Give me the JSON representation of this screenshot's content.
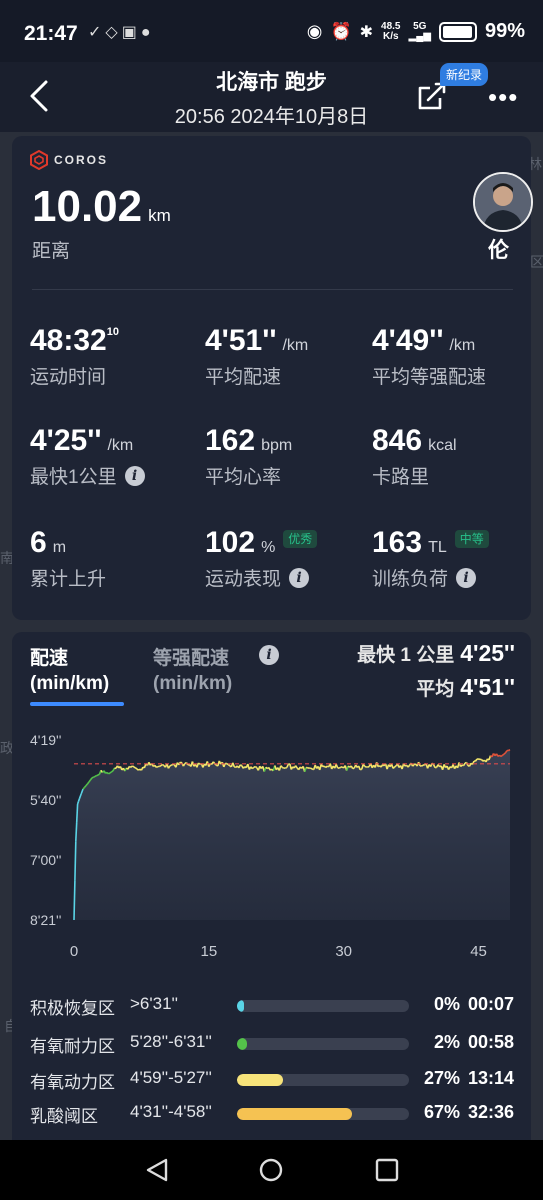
{
  "status_bar": {
    "time": "21:47",
    "battery": "99%",
    "net_speed_top": "48.5",
    "net_speed_bottom": "K/s",
    "signal": "5G"
  },
  "header": {
    "title": "北海市 跑步",
    "subtitle": "20:56 2024年10月8日",
    "badge": "新纪录"
  },
  "map_labels": [
    "林",
    "南",
    "区",
    "政",
    "自"
  ],
  "summary": {
    "brand": "COROS",
    "distance_value": "10.02",
    "distance_unit": "km",
    "distance_label": "距离",
    "user_name": "伦",
    "metrics": [
      {
        "value": "48:32",
        "sup": "10",
        "unit": "",
        "label": "运动时间"
      },
      {
        "value": "4'51''",
        "unit": "/km",
        "label": "平均配速"
      },
      {
        "value": "4'49''",
        "unit": "/km",
        "label": "平均等强配速"
      },
      {
        "value": "4'25''",
        "unit": "/km",
        "label": "最快1公里",
        "info": true
      },
      {
        "value": "162",
        "unit": "bpm",
        "label": "平均心率"
      },
      {
        "value": "846",
        "unit": "kcal",
        "label": "卡路里"
      },
      {
        "value": "6",
        "unit": "m",
        "label": "累计上升"
      },
      {
        "value": "102",
        "unit": "%",
        "tag": "优秀",
        "label": "运动表现",
        "info": true
      },
      {
        "value": "163",
        "unit": "TL",
        "tag": "中等",
        "label": "训练负荷",
        "info": true
      }
    ]
  },
  "pace_panel": {
    "tab_active": "配速",
    "tab_active_unit": "(min/km)",
    "tab_inactive": "等强配速",
    "tab_inactive_unit": "(min/km)",
    "fastest_label": "最快 1 公里",
    "fastest_value": "4'25''",
    "avg_label": "平均",
    "avg_value": "4'51''"
  },
  "chart_data": {
    "type": "area",
    "x_label": "",
    "y_label": "",
    "x_range": [
      0,
      48.5
    ],
    "x_ticks": [
      0,
      15,
      30,
      45
    ],
    "y_ticks": [
      "4'19''",
      "5'40''",
      "7'00''",
      "8'21''"
    ],
    "y_tick_seconds": [
      259,
      340,
      420,
      501
    ],
    "y_inverted": true,
    "reference_line": {
      "label": "average",
      "seconds": 291
    },
    "series": [
      {
        "x": [
          0,
          0.2,
          0.4,
          0.6,
          1,
          1.5,
          2,
          3,
          4,
          5,
          6,
          7,
          8,
          9,
          10,
          12,
          14,
          16,
          18,
          20,
          22,
          24,
          26,
          28,
          30,
          32,
          34,
          36,
          38,
          40,
          42,
          44,
          45,
          46,
          47,
          48,
          48.5
        ],
        "seconds": [
          501,
          395,
          345,
          338,
          325,
          318,
          310,
          304,
          301,
          297,
          296,
          298,
          294,
          292,
          295,
          291,
          293,
          290,
          294,
          296,
          298,
          295,
          298,
          294,
          296,
          295,
          293,
          295,
          292,
          294,
          296,
          290,
          287,
          284,
          280,
          276,
          272
        ]
      }
    ],
    "colors": {
      "fast": "#e0533a",
      "mid": "#f3e66a",
      "slow": "#54c24a",
      "warmup": "#5ad4e6",
      "ref": "#d94c4c"
    }
  },
  "zones": [
    {
      "name": "积极恢复区",
      "range": ">6'31''",
      "percent": "0%",
      "fraction": 0.04,
      "time": "00:07",
      "color": "#5ad4e6"
    },
    {
      "name": "有氧耐力区",
      "range": "5'28''-6'31''",
      "percent": "2%",
      "fraction": 0.06,
      "time": "00:58",
      "color": "#54c24a"
    },
    {
      "name": "有氧动力区",
      "range": "4'59''-5'27''",
      "percent": "27%",
      "fraction": 0.27,
      "time": "13:14",
      "color": "#f7e37a"
    },
    {
      "name": "乳酸阈区",
      "range": "4'31''-4'58''",
      "percent": "67%",
      "fraction": 0.67,
      "time": "32:36",
      "color": "#f5c252"
    }
  ]
}
